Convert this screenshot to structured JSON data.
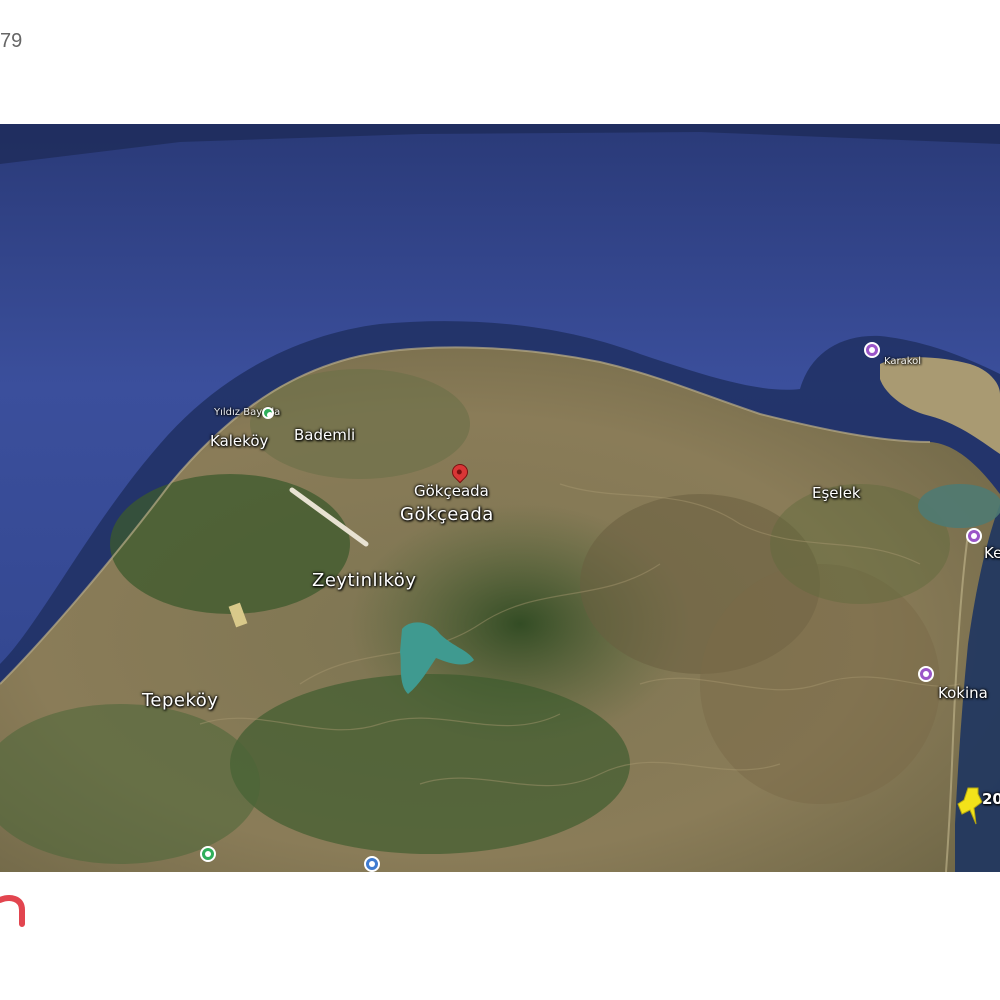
{
  "header": {
    "listing_number_fragment": "79"
  },
  "map": {
    "places": {
      "yildiz_bay": "Yıldız Bay Pla",
      "kalekoy": "Kaleköy",
      "bademli": "Bademli",
      "gokceada_pin": "Gökçeada",
      "gokceada": "Gökçeada",
      "eselek": "Eşelek",
      "zeytinlikoy": "Zeytinliköy",
      "tepekoy": "Tepeköy",
      "kokina": "Kokina",
      "ke": "Ke",
      "karakol": "Karakol"
    },
    "marker_label": "20",
    "colors": {
      "sea": "#3b4f9c",
      "land": "#8a7c58",
      "forest": "#3c5a2c",
      "reservoir": "#3f9a90",
      "poi_purple": "#9a55c8",
      "poi_green": "#2fae5a",
      "poi_blue": "#3f7bd0",
      "marker_yellow": "#f2e21a",
      "brand_red": "#e2454f"
    },
    "icons": [
      "location-pin-icon",
      "poi-icon",
      "pushpin-icon"
    ]
  }
}
